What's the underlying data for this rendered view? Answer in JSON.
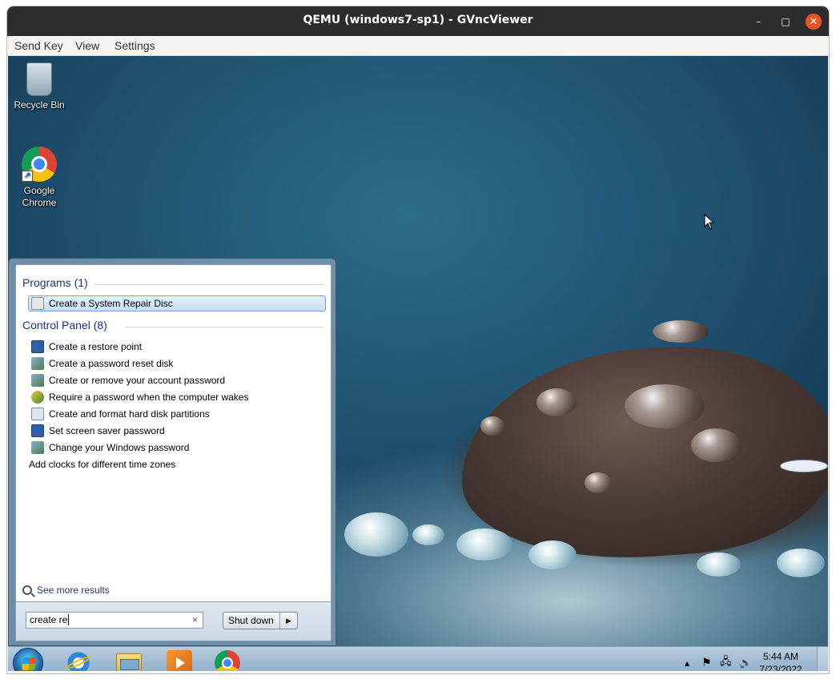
{
  "window": {
    "title": "QEMU (windows7-sp1) - GVncViewer",
    "controls": {
      "minimize": "–",
      "maximize": "□",
      "close": "✕"
    }
  },
  "menubar": {
    "items": [
      "Send Key",
      "View",
      "Settings"
    ]
  },
  "desktop": {
    "icons": [
      {
        "label": "Recycle Bin",
        "icon": "recycle-bin-icon"
      },
      {
        "label": "Google Chrome",
        "icon": "chrome-icon",
        "shortcut_glyph": "↗"
      }
    ]
  },
  "start_menu": {
    "programs": {
      "header": "Programs (1)",
      "items": [
        {
          "label": "Create a System Repair Disc",
          "icon": "repair-disc-icon",
          "selected": true
        }
      ]
    },
    "control_panel": {
      "header": "Control Panel (8)",
      "items": [
        {
          "label": "Create a restore point",
          "icon": "monitor-icon"
        },
        {
          "label": "Create a password reset disk",
          "icon": "users-icon"
        },
        {
          "label": "Create or remove your account password",
          "icon": "users-icon"
        },
        {
          "label": "Require a password when the computer wakes",
          "icon": "power-shield-icon"
        },
        {
          "label": "Create and format hard disk partitions",
          "icon": "disk-icon"
        },
        {
          "label": "Set screen saver password",
          "icon": "monitor-icon"
        },
        {
          "label": "Change your Windows password",
          "icon": "users-icon"
        },
        {
          "label": "Add clocks for different time zones",
          "icon": "clock-icon"
        }
      ]
    },
    "see_more": "See more results",
    "search": {
      "value": "create re",
      "clear": "×"
    },
    "shutdown": {
      "label": "Shut down",
      "arrow": "▶"
    }
  },
  "taskbar": {
    "apps": [
      "internet-explorer-icon",
      "explorer-icon",
      "media-player-icon",
      "chrome-icon"
    ],
    "tray": {
      "up_arrow": "▲",
      "flag": "⚑",
      "network": "🖧",
      "volume": "🔊"
    },
    "clock": {
      "time": "5:44 AM",
      "date": "7/23/2022"
    }
  }
}
